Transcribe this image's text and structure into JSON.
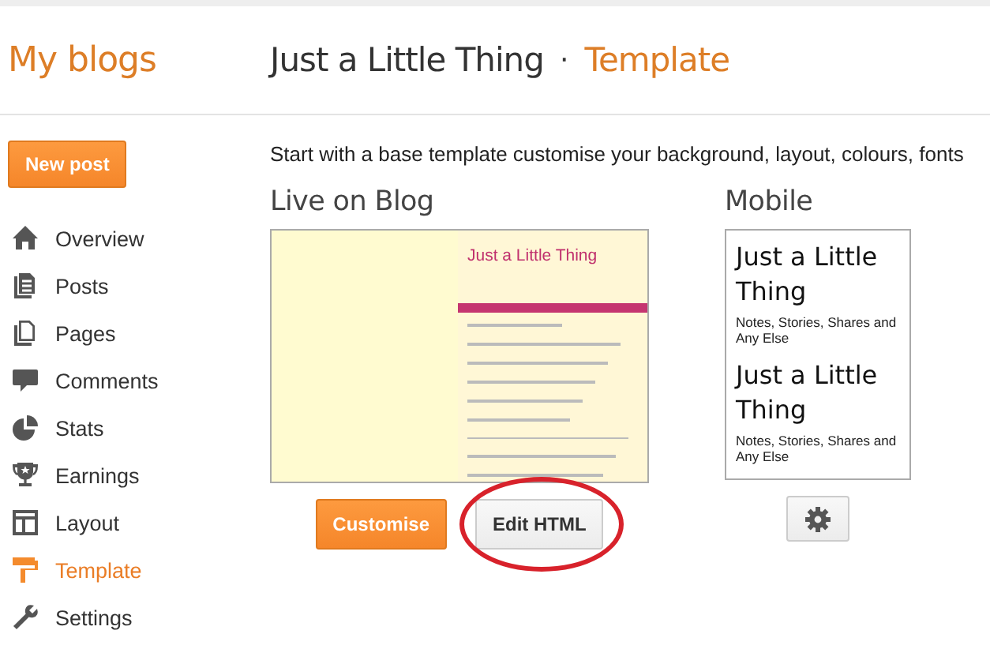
{
  "header": {
    "app_title": "My blogs",
    "blog_name": "Just a Little Thing",
    "separator": "·",
    "section": "Template"
  },
  "sidebar": {
    "new_post": "New post",
    "items": [
      {
        "label": "Overview",
        "selected": false
      },
      {
        "label": "Posts",
        "selected": false
      },
      {
        "label": "Pages",
        "selected": false
      },
      {
        "label": "Comments",
        "selected": false
      },
      {
        "label": "Stats",
        "selected": false
      },
      {
        "label": "Earnings",
        "selected": false
      },
      {
        "label": "Layout",
        "selected": false
      },
      {
        "label": "Template",
        "selected": true
      },
      {
        "label": "Settings",
        "selected": false
      }
    ]
  },
  "main": {
    "intro": "Start with a base template customise your background, layout, colours, fonts",
    "live": {
      "heading": "Live on Blog",
      "preview_title": "Just a Little Thing",
      "buttons": [
        "Customise",
        "Edit HTML"
      ]
    },
    "mobile": {
      "heading": "Mobile",
      "entries": [
        {
          "title": "Just a Little Thing",
          "subtitle": "Notes, Stories, Shares and Any Else"
        },
        {
          "title": "Just a Little Thing",
          "subtitle": "Notes, Stories, Shares and Any Else"
        }
      ]
    }
  }
}
